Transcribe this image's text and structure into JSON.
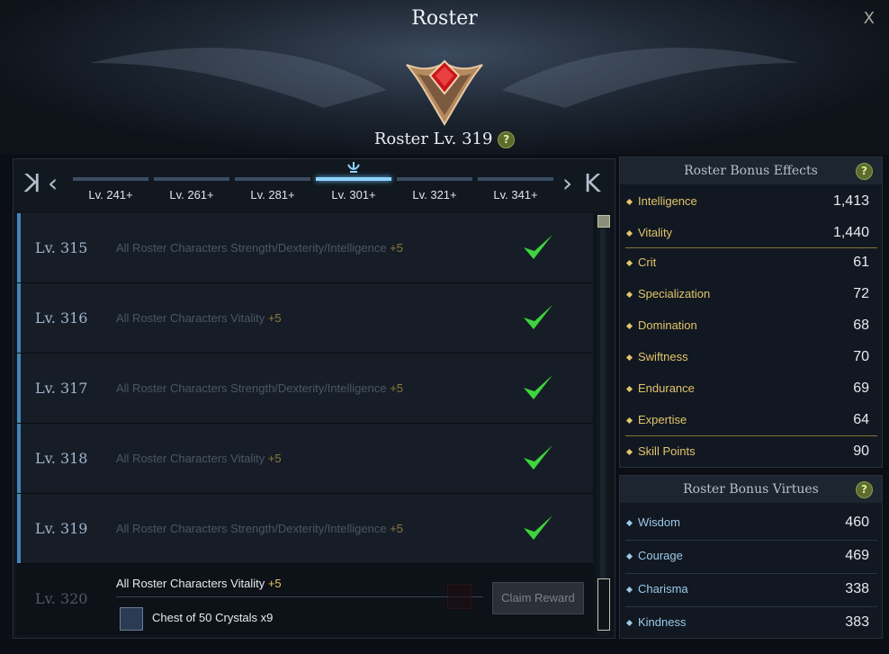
{
  "window": {
    "title": "Roster",
    "close_label": "X"
  },
  "roster": {
    "level_label": "Roster Lv. 319",
    "help": "?"
  },
  "nav": {
    "first": "K",
    "prev": "‹",
    "next": "›",
    "last": "K",
    "ranges": [
      {
        "label": "Lv. 241+",
        "active": false
      },
      {
        "label": "Lv. 261+",
        "active": false
      },
      {
        "label": "Lv. 281+",
        "active": false
      },
      {
        "label": "Lv. 301+",
        "active": true
      },
      {
        "label": "Lv. 321+",
        "active": false
      },
      {
        "label": "Lv. 341+",
        "active": false
      }
    ]
  },
  "levels": [
    {
      "level": "Lv. 315",
      "desc": "All Roster Characters Strength/Dexterity/Intelligence",
      "bonus": "+5",
      "claimed": true
    },
    {
      "level": "Lv. 316",
      "desc": "All Roster Characters Vitality",
      "bonus": "+5",
      "claimed": true
    },
    {
      "level": "Lv. 317",
      "desc": "All Roster Characters Strength/Dexterity/Intelligence",
      "bonus": "+5",
      "claimed": true
    },
    {
      "level": "Lv. 318",
      "desc": "All Roster Characters Vitality",
      "bonus": "+5",
      "claimed": true
    },
    {
      "level": "Lv. 319",
      "desc": "All Roster Characters Strength/Dexterity/Intelligence",
      "bonus": "+5",
      "claimed": true
    },
    {
      "level": "Lv. 320",
      "desc": "All Roster Characters Vitality",
      "bonus": "+5",
      "claimed": false,
      "reward": "Chest of 50 Crystals x9",
      "button": "Claim Reward"
    }
  ],
  "bonus_effects": {
    "title": "Roster Bonus Effects",
    "help": "?",
    "stats": [
      {
        "name": "Intelligence",
        "value": "1,413"
      },
      {
        "name": "Vitality",
        "value": "1,440"
      },
      {
        "name": "Crit",
        "value": "61"
      },
      {
        "name": "Specialization",
        "value": "72"
      },
      {
        "name": "Domination",
        "value": "68"
      },
      {
        "name": "Swiftness",
        "value": "70"
      },
      {
        "name": "Endurance",
        "value": "69"
      },
      {
        "name": "Expertise",
        "value": "64"
      },
      {
        "name": "Skill Points",
        "value": "90"
      }
    ]
  },
  "bonus_virtues": {
    "title": "Roster Bonus Virtues",
    "help": "?",
    "stats": [
      {
        "name": "Wisdom",
        "value": "460"
      },
      {
        "name": "Courage",
        "value": "469"
      },
      {
        "name": "Charisma",
        "value": "338"
      },
      {
        "name": "Kindness",
        "value": "383"
      }
    ]
  },
  "colors": {
    "stat_gold": "#e3c46a",
    "virtue_blue": "#9cc8e8",
    "check_green": "#3fd43f",
    "accent": "#3f87b8"
  }
}
